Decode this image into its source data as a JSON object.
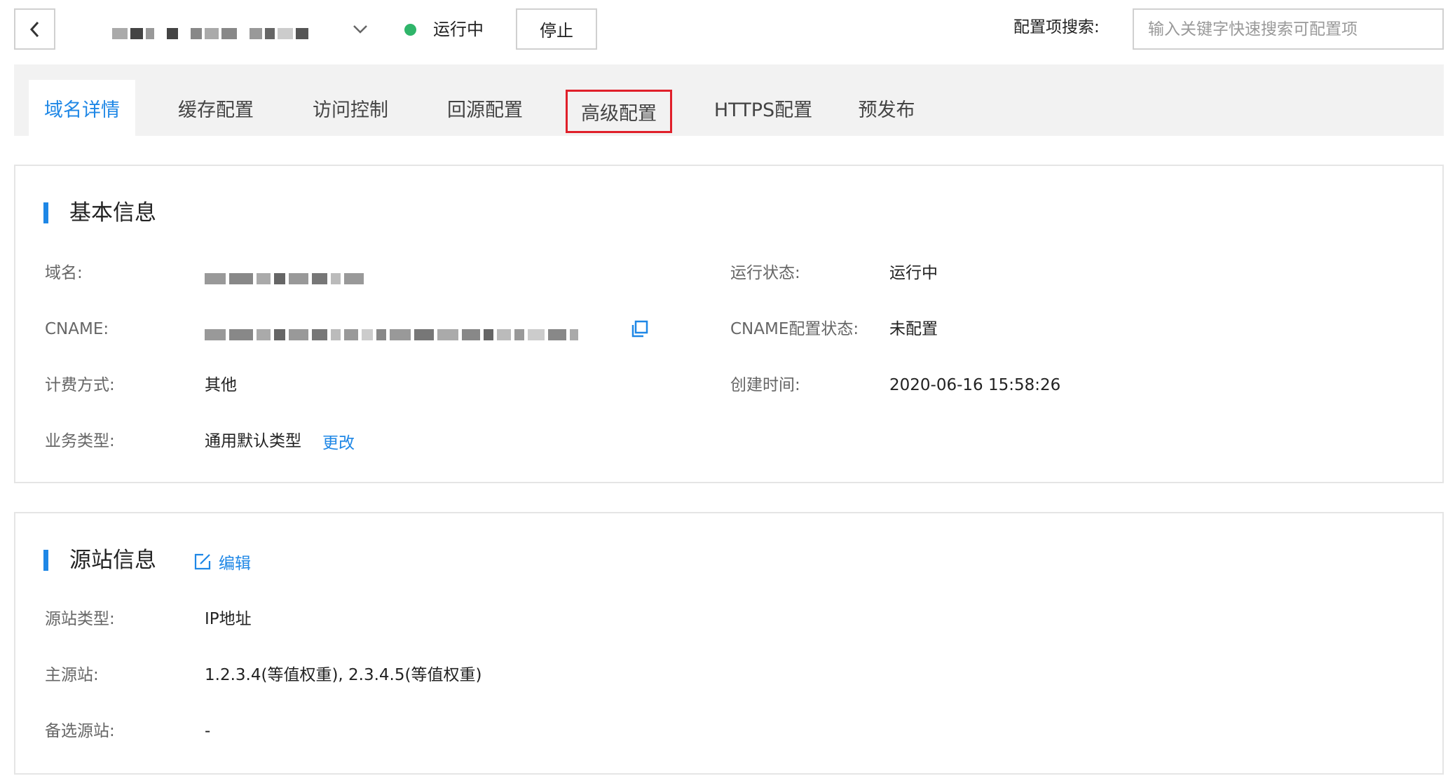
{
  "header": {
    "status": "运行中",
    "stop_label": "停止",
    "search_label": "配置项搜索:",
    "search_placeholder": "输入关键字快速搜索可配置项",
    "search_value": ""
  },
  "tabs": [
    {
      "label": "域名详情",
      "active": true
    },
    {
      "label": "缓存配置"
    },
    {
      "label": "访问控制"
    },
    {
      "label": "回源配置"
    },
    {
      "label": "高级配置",
      "highlighted": true
    },
    {
      "label": "HTTPS配置"
    },
    {
      "label": "预发布"
    }
  ],
  "basic": {
    "title": "基本信息",
    "domain_label": "域名:",
    "cname_label": "CNAME:",
    "billing_label": "计费方式:",
    "billing_value": "其他",
    "biz_label": "业务类型:",
    "biz_value": "通用默认类型",
    "biz_change": "更改",
    "run_status_label": "运行状态:",
    "run_status_value": "运行中",
    "cname_status_label": "CNAME配置状态:",
    "cname_status_value": "未配置",
    "created_label": "创建时间:",
    "created_value": "2020-06-16 15:58:26"
  },
  "origin": {
    "title": "源站信息",
    "edit_label": "编辑",
    "type_label": "源站类型:",
    "type_value": "IP地址",
    "primary_label": "主源站:",
    "primary_value": "1.2.3.4(等值权重), 2.3.4.5(等值权重)",
    "backup_label": "备选源站:",
    "backup_value": "-"
  },
  "colors": {
    "accent": "#1e87e6",
    "status_green": "#2fb56a",
    "highlight_red": "#e0202a"
  }
}
